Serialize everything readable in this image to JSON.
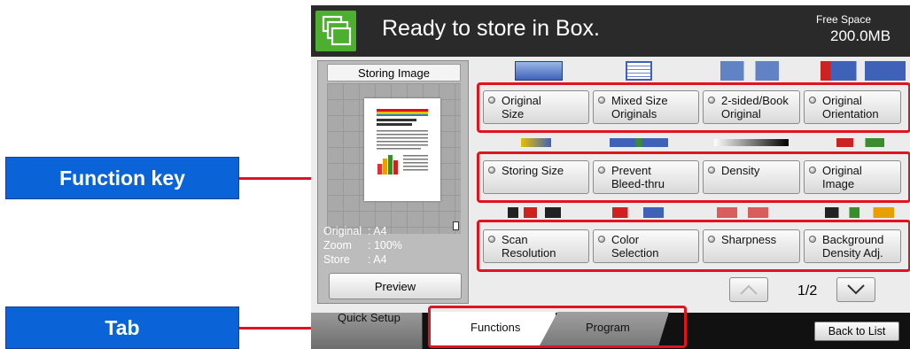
{
  "callouts": {
    "function_key": "Function key",
    "tab": "Tab"
  },
  "header": {
    "title": "Ready to store in Box.",
    "free_space_label": "Free Space",
    "free_space_value": "200.0MB"
  },
  "preview_panel": {
    "title": "Storing Image",
    "info": [
      {
        "key": "Original",
        "value": ": A4"
      },
      {
        "key": "Zoom",
        "value": ": 100%"
      },
      {
        "key": "Store",
        "value": ": A4"
      }
    ],
    "preview_button": "Preview"
  },
  "function_rows": [
    [
      {
        "line1": "Original",
        "line2": "Size"
      },
      {
        "line1": "Mixed Size",
        "line2": "Originals"
      },
      {
        "line1": "2-sided/Book",
        "line2": "Original"
      },
      {
        "line1": "Original",
        "line2": "Orientation"
      }
    ],
    [
      {
        "line1": "Storing Size",
        "line2": ""
      },
      {
        "line1": "Prevent",
        "line2": "Bleed-thru"
      },
      {
        "line1": "Density",
        "line2": ""
      },
      {
        "line1": "Original",
        "line2": "Image"
      }
    ],
    [
      {
        "line1": "Scan",
        "line2": "Resolution"
      },
      {
        "line1": "Color",
        "line2": "Selection"
      },
      {
        "line1": "Sharpness",
        "line2": ""
      },
      {
        "line1": "Background",
        "line2": "Density Adj."
      }
    ]
  ],
  "pagination": {
    "page": "1/2"
  },
  "tabs": {
    "quick_setup": "Quick Setup",
    "functions": "Functions",
    "program": "Program"
  },
  "back_to_list": "Back to List",
  "colors": {
    "accent_green": "#4caf2f",
    "callout_blue": "#0a64d8",
    "highlight_red": "#e0141e"
  },
  "icons": [
    "box-folder-icon",
    "chevron-up-icon",
    "chevron-down-icon",
    "toner-icon"
  ]
}
